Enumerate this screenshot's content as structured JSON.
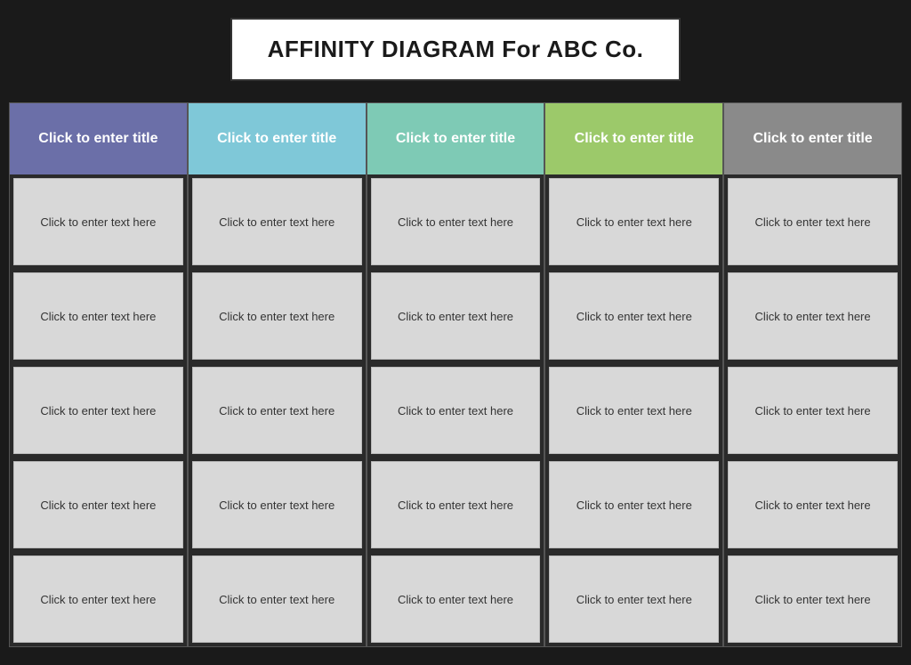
{
  "title": "AFFINITY DIAGRAM For ABC Co.",
  "columns": [
    {
      "id": "col-1",
      "header": "Click to enter title",
      "color": "#6b6fa8",
      "cards": [
        "Click to enter text here",
        "Click to enter text here",
        "Click to enter text here",
        "Click to enter text here",
        "Click to enter text here"
      ]
    },
    {
      "id": "col-2",
      "header": "Click to enter title",
      "color": "#7fc8d8",
      "cards": [
        "Click to enter text here",
        "Click to enter text here",
        "Click to enter text here",
        "Click to enter text here",
        "Click to enter text here"
      ]
    },
    {
      "id": "col-3",
      "header": "Click to enter title",
      "color": "#7ecab5",
      "cards": [
        "Click to enter text here",
        "Click to enter text here",
        "Click to enter text here",
        "Click to enter text here",
        "Click to enter text here"
      ]
    },
    {
      "id": "col-4",
      "header": "Click to enter title",
      "color": "#9cc96a",
      "cards": [
        "Click to enter text here",
        "Click to enter text here",
        "Click to enter text here",
        "Click to enter text here",
        "Click to enter text here"
      ]
    },
    {
      "id": "col-5",
      "header": "Click to enter title",
      "color": "#8a8a8a",
      "cards": [
        "Click to enter text here",
        "Click to enter text here",
        "Click to enter text here",
        "Click to enter text here",
        "Click to enter text here"
      ]
    }
  ]
}
